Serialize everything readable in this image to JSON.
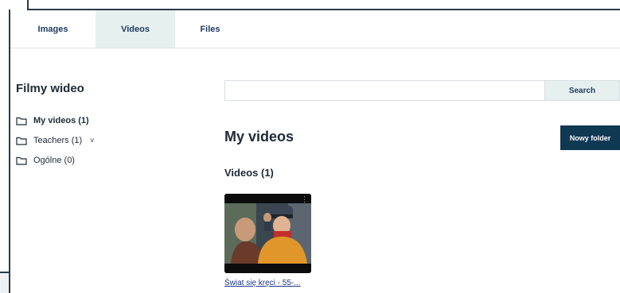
{
  "tabs": [
    {
      "label": "Images"
    },
    {
      "label": "Videos"
    },
    {
      "label": "Files"
    }
  ],
  "sidebar": {
    "title": "Filmy wideo",
    "items": [
      {
        "label": "My videos (1)",
        "icon": "folder-icon"
      },
      {
        "label": "Teachers (1)",
        "icon": "folder-icon",
        "expand_glyph": "˅"
      },
      {
        "label": "Ogólne (0)",
        "icon": "folder-icon"
      }
    ]
  },
  "search": {
    "placeholder": "",
    "button_label": "Search"
  },
  "main": {
    "title": "My videos",
    "new_folder_label": "Nowy folder",
    "section_title": "Videos (1)",
    "videos": [
      {
        "title": "Świat się kręci - 55-...",
        "menu_glyph": "⋮"
      }
    ]
  },
  "colors": {
    "accent_dark": "#0f3852",
    "tab_active_bg": "#e6f0ef",
    "link": "#1e3a8a"
  }
}
